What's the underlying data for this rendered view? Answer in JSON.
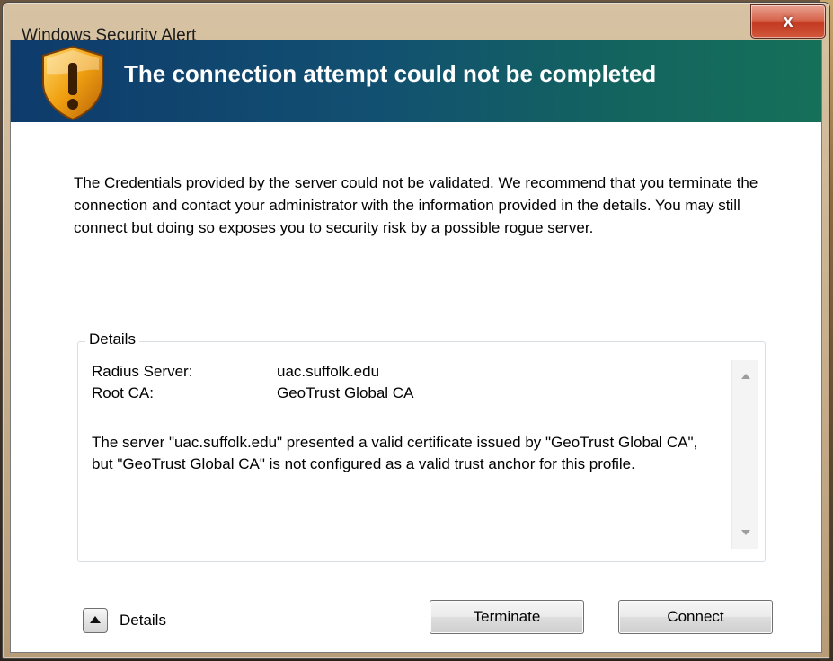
{
  "window": {
    "title": "Windows Security Alert",
    "close_glyph": "x"
  },
  "banner": {
    "icon": "shield-warning-icon",
    "heading": "The connection attempt could not be completed"
  },
  "message": "The Credentials provided by the server could not be validated. We recommend that you terminate the connection and contact your administrator with the information provided in the details. You may still connect but doing so exposes you to security risk by a possible rogue server.",
  "details": {
    "group_label": "Details",
    "rows": [
      {
        "key": "Radius Server:",
        "value": "uac.suffolk.edu"
      },
      {
        "key": "Root CA:",
        "value": "GeoTrust Global CA"
      }
    ],
    "text": "The server \"uac.suffolk.edu\" presented a valid certificate issued by \"GeoTrust Global CA\", but \"GeoTrust Global CA\" is not configured as a valid trust anchor for this profile."
  },
  "footer": {
    "toggle_label": "Details",
    "terminate_label": "Terminate",
    "connect_label": "Connect"
  },
  "colors": {
    "banner_start": "#0e3b6c",
    "banner_end": "#157059",
    "close_red": "#c33a21",
    "shield_orange": "#f0a010"
  }
}
